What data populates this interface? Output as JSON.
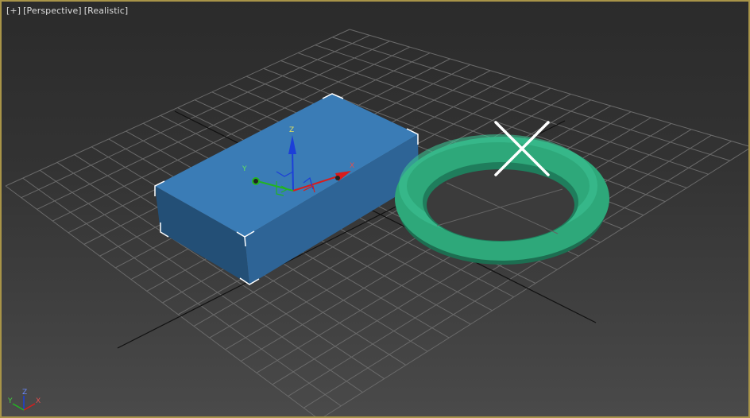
{
  "viewport": {
    "menu_plus": "[+]",
    "view_label": "[Perspective]",
    "shading_label": "[Realistic]"
  },
  "gizmo": {
    "z": "Z",
    "y": "Y",
    "x": "X"
  },
  "orientation_tripod": {
    "z": "Z",
    "y": "Y",
    "x": "X"
  },
  "colors": {
    "viewport_border": "#a89448",
    "box_top": "#3a7cb6",
    "torus": "#2ea87a",
    "grid": "#6a6a6a",
    "axis_x": "#d81c1c",
    "axis_y": "#22b422",
    "axis_z": "#1c3fd8"
  },
  "objects": [
    "box",
    "torus"
  ],
  "icons": [
    "close-x-icon",
    "transform-gizmo",
    "view-cube-axis-tripod"
  ]
}
